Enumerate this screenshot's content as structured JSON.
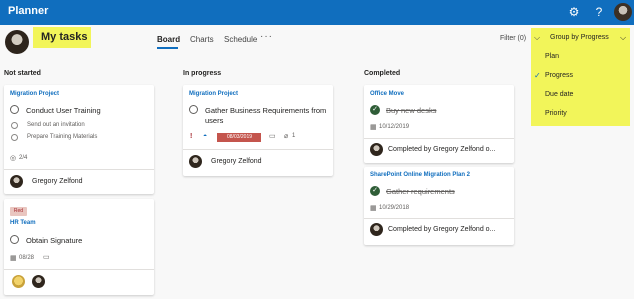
{
  "app": {
    "title": "Planner"
  },
  "header": {
    "page_title": "My tasks",
    "tabs": [
      {
        "label": "Board",
        "active": true
      },
      {
        "label": "Charts",
        "active": false
      },
      {
        "label": "Schedule",
        "active": false
      }
    ],
    "more": "···",
    "filter_label": "Filter (0)",
    "group_by_label": "Group by Progress"
  },
  "group_menu": {
    "items": [
      {
        "label": "Plan",
        "selected": false
      },
      {
        "label": "Progress",
        "selected": true
      },
      {
        "label": "Due date",
        "selected": false
      },
      {
        "label": "Priority",
        "selected": false
      }
    ]
  },
  "columns": {
    "not_started": {
      "title": "Not started",
      "cards": [
        {
          "bucket": "Migration Project",
          "title": "Conduct User Training",
          "checklist": [
            "Send out an invitation",
            "Prepare Training Materials"
          ],
          "checklist_count": "2/4",
          "assignee": "Gregory Zelfond"
        },
        {
          "label": "Red",
          "bucket": "HR Team",
          "title": "Obtain Signature",
          "due": "08/28"
        }
      ]
    },
    "in_progress": {
      "title": "In progress",
      "cards": [
        {
          "bucket": "Migration Project",
          "title_line1": "Gather Business Requirements from",
          "title_line2": "users",
          "priority": "!",
          "due": "08/03/2019",
          "attachments": "1",
          "assignee": "Gregory Zelfond"
        }
      ]
    },
    "completed": {
      "title": "Completed",
      "cards": [
        {
          "bucket": "Office Move",
          "title": "Buy new desks",
          "date": "10/12/2019",
          "completed_by": "Completed by Gregory Zelfond o..."
        },
        {
          "bucket": "SharePoint Online Migration Plan 2",
          "title": "Gather requirements",
          "date": "10/29/2018",
          "completed_by": "Completed by Gregory Zelfond o..."
        }
      ]
    }
  },
  "colors": {
    "topbar": "#106ebe",
    "highlight": "#f2f55a",
    "accent": "#106ebe",
    "completed_check": "#2f5d37"
  }
}
